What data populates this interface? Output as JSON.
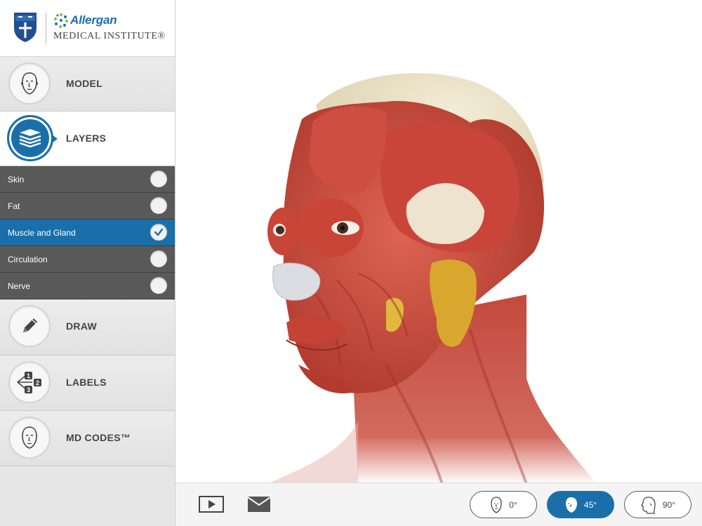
{
  "logo": {
    "brand": "Allergan",
    "subtitle": "MEDICAL INSTITUTE®"
  },
  "menu": {
    "model_label": "MODEL",
    "layers_label": "LAYERS",
    "draw_label": "DRAW",
    "labels_label": "LABELS",
    "mdcodes_label": "MD CODES™"
  },
  "layers": {
    "items": [
      {
        "label": "Skin",
        "checked": false
      },
      {
        "label": "Fat",
        "checked": false
      },
      {
        "label": "Muscle and Gland",
        "checked": true
      },
      {
        "label": "Circulation",
        "checked": false
      },
      {
        "label": "Nerve",
        "checked": false
      }
    ]
  },
  "labels_icon": {
    "n1": "1",
    "n2": "2",
    "n3": "3"
  },
  "toolbar": {
    "angles": [
      {
        "label": "0°",
        "active": false
      },
      {
        "label": "45°",
        "active": true
      },
      {
        "label": "90°",
        "active": false
      }
    ]
  },
  "icons": {
    "model": "face-front-icon",
    "layers": "layers-stack-icon",
    "draw": "pencil-icon",
    "labels": "numbered-labels-icon",
    "mdcodes": "face-front-icon",
    "play": "play-icon",
    "mail": "envelope-icon",
    "checked": "checkmark-icon"
  },
  "colors": {
    "accent": "#1a6fab",
    "layer_bg": "#595959",
    "muscle": "#c94a3e",
    "gland": "#d9a72e"
  }
}
